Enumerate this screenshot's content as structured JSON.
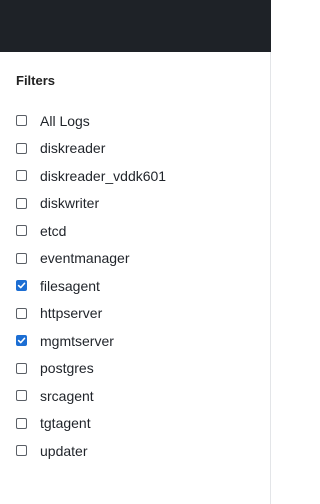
{
  "panel": {
    "title": "Filters"
  },
  "filters": [
    {
      "label": "All Logs",
      "checked": false
    },
    {
      "label": "diskreader",
      "checked": false
    },
    {
      "label": "diskreader_vddk601",
      "checked": false
    },
    {
      "label": "diskwriter",
      "checked": false
    },
    {
      "label": "etcd",
      "checked": false
    },
    {
      "label": "eventmanager",
      "checked": false
    },
    {
      "label": "filesagent",
      "checked": true
    },
    {
      "label": "httpserver",
      "checked": false
    },
    {
      "label": "mgmtserver",
      "checked": true
    },
    {
      "label": "postgres",
      "checked": false
    },
    {
      "label": "srcagent",
      "checked": false
    },
    {
      "label": "tgtagent",
      "checked": false
    },
    {
      "label": "updater",
      "checked": false
    }
  ],
  "colors": {
    "topbar": "#1e2227",
    "checkbox_checked": "#1c6ed3",
    "checkbox_border": "#5a5f66",
    "text": "#1f2329"
  }
}
